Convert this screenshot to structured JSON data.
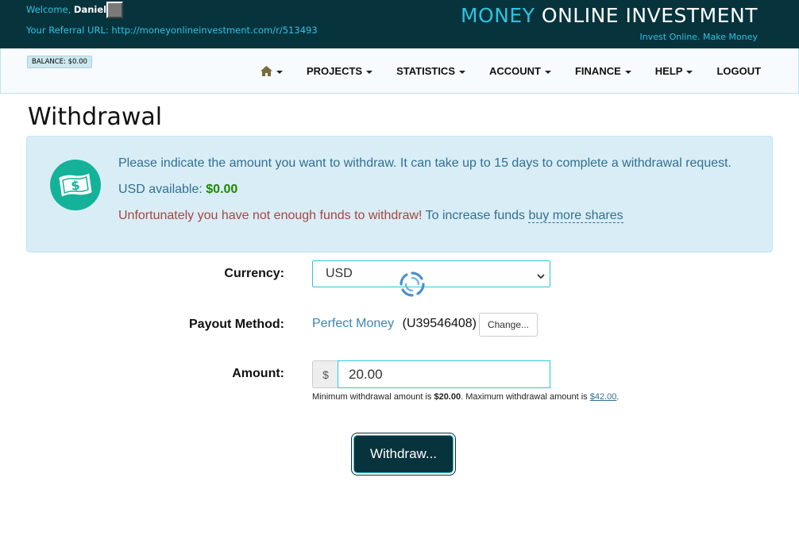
{
  "header": {
    "welcome_prefix": "Welcome,",
    "username": "Daniel",
    "referral_prefix": "Your Referral URL:",
    "referral_url": "http://moneyonlineinvestment.com/r/513493",
    "brand_part1": "MONEY",
    "brand_part2": "ONLINE INVESTMENT",
    "tagline": "Invest Online. Make Money",
    "balance": "BALANCE: $0.00"
  },
  "nav": {
    "home_icon": "home-icon",
    "items": [
      {
        "label": "PROJECTS",
        "dropdown": true
      },
      {
        "label": "STATISTICS",
        "dropdown": true
      },
      {
        "label": "ACCOUNT",
        "dropdown": true
      },
      {
        "label": "FINANCE",
        "dropdown": true
      },
      {
        "label": "HELP",
        "dropdown": true
      },
      {
        "label": "LOGOUT",
        "dropdown": false
      }
    ]
  },
  "page": {
    "title": "Withdrawal"
  },
  "alert": {
    "icon": "money-icon",
    "line1": "Please indicate the amount you want to withdraw. It can take up to 15 days to complete a withdrawal request.",
    "usd_label": "USD available:",
    "usd_value": "$0.00",
    "error_text": "Unfortunately you have not enough funds to withdraw!",
    "increase_text": "To increase funds",
    "buy_link": "buy more shares"
  },
  "form": {
    "currency_label": "Currency:",
    "currency_value": "USD",
    "payout_label": "Payout Method:",
    "payout_method": "Perfect Money",
    "payout_account": "(U39546408)",
    "change_button": "Change...",
    "amount_label": "Amount:",
    "currency_symbol": "$",
    "amount_value": "20.00",
    "help_min_prefix": "Minimum withdrawal amount is",
    "help_min_value": "$20.00",
    "help_max_prefix": ". Maximum withdrawal amount is",
    "help_max_value": "$42.00",
    "help_suffix": ".",
    "submit_label": "Withdraw..."
  },
  "colors": {
    "header_bg": "#07333d",
    "accent": "#2ec3e0",
    "alert_bg": "#d9edf7",
    "success": "#1a8a00",
    "error": "#a94442",
    "icon_bg": "#15b29a"
  }
}
